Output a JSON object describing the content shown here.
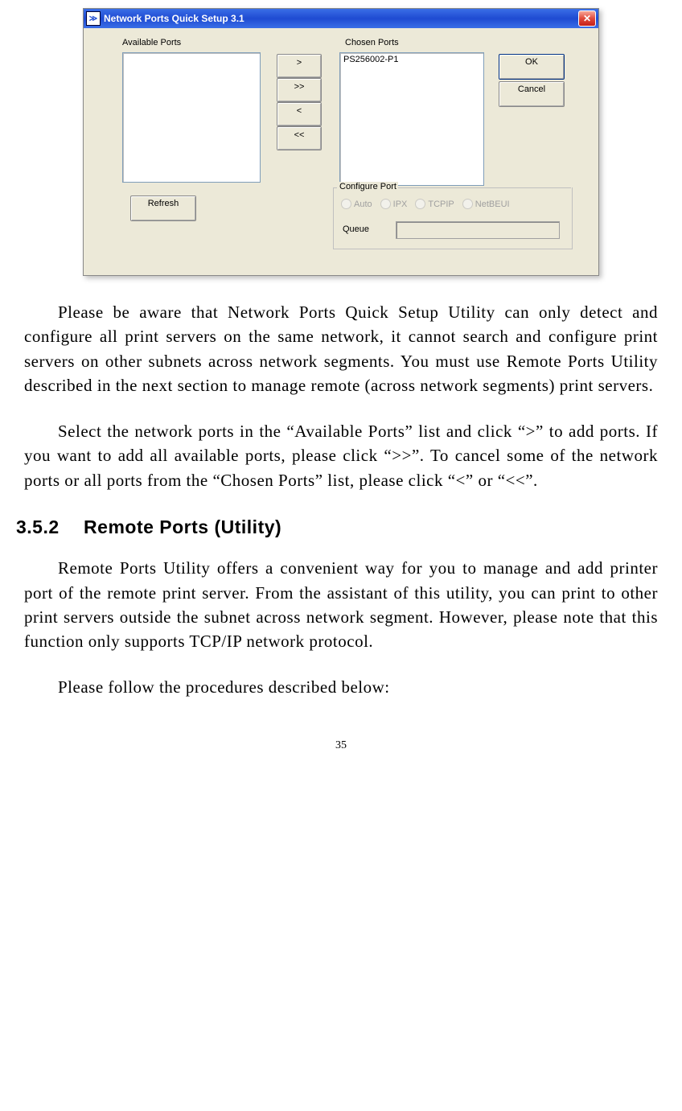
{
  "dialog": {
    "title": "Network Ports Quick Setup 3.1",
    "labels": {
      "available": "Available Ports",
      "chosen": "Chosen Ports"
    },
    "chosen_items": [
      "PS256002-P1"
    ],
    "buttons": {
      "add_one": ">",
      "add_all": ">>",
      "remove_one": "<",
      "remove_all": "<<",
      "refresh": "Refresh",
      "ok": "OK",
      "cancel": "Cancel"
    },
    "configure_port": {
      "group_title": "Configure Port",
      "radios": {
        "auto": "Auto",
        "ipx": "IPX",
        "tcpip": "TCPIP",
        "netbeui": "NetBEUI"
      },
      "queue_label": "Queue"
    }
  },
  "body": {
    "para1": "Please be aware that Network Ports Quick Setup Utility can only detect and configure all print servers on the same network, it cannot search and configure print servers on other subnets across network segments. You must use Remote Ports Utility described in the next section to manage remote (across network segments) print servers.",
    "para2": "Select the network ports in the “Available Ports” list and click “>” to add ports. If you want to add all available ports, please click “>>”. To cancel some of the network ports or all ports from the “Chosen Ports” list, please click “<” or “<<”.",
    "heading": "3.5.2  Remote Ports (Utility)",
    "para3": "Remote Ports Utility offers a convenient way for you to manage and add printer port of the remote print server. From the assistant of this utility, you can print to other print servers outside the subnet across network segment. However, please note that this function only supports TCP/IP network protocol.",
    "para4": "Please follow the procedures described below:"
  },
  "pagenum": "35",
  "chart_data": null
}
